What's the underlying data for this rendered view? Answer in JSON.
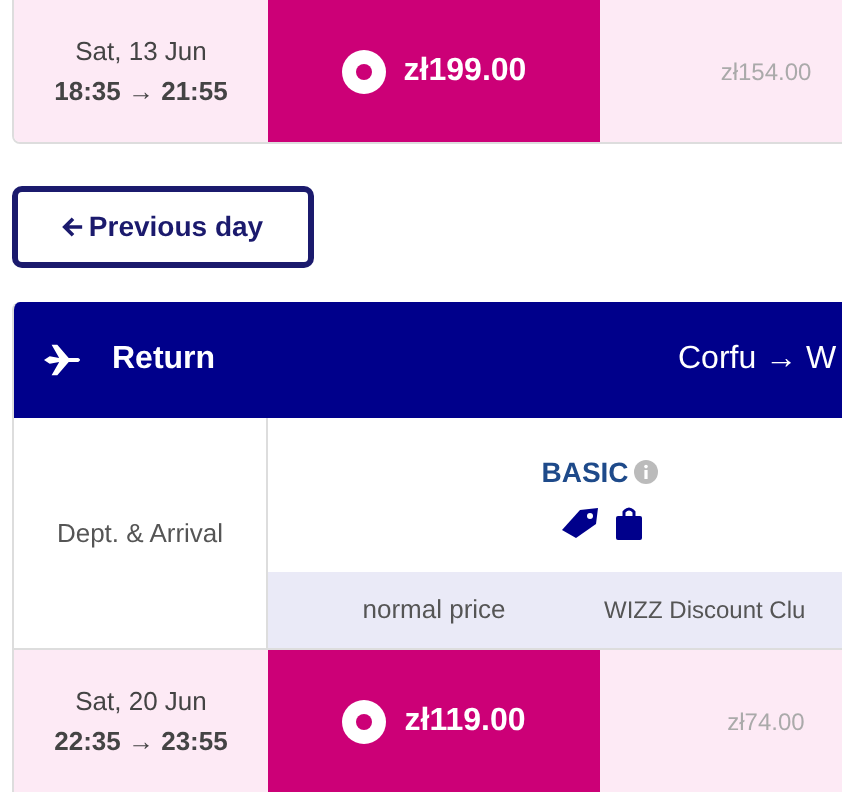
{
  "outbound_row": {
    "date": "Sat, 13 Jun",
    "times": "18:35 → 21:55",
    "normal_price": "zł199.00",
    "club_price": "zł154.00",
    "selected": true
  },
  "previous_day_button": "Previous day",
  "return_section": {
    "title": "Return",
    "route": "Corfu → W",
    "dept_arrival_label": "Dept. & Arrival",
    "fare_name": "BASIC",
    "price_types": [
      "normal price",
      "WIZZ Discount Clu"
    ],
    "rows": [
      {
        "date": "Sat, 20 Jun",
        "times": "22:35 → 23:55",
        "normal_price": "zł119.00",
        "club_price": "zł74.00",
        "selected": true
      }
    ]
  }
}
